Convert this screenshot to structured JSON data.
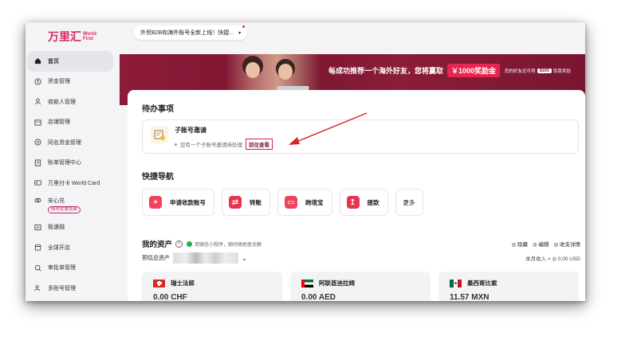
{
  "brand": {
    "name_cn": "万里汇",
    "name_en_1": "World",
    "name_en_2": "First"
  },
  "notice": {
    "text": "外贸B2B和海外账号全新上线！快捷...",
    "caret": "▾"
  },
  "sidebar": {
    "items": [
      {
        "label": "首页",
        "icon": "home-icon"
      },
      {
        "label": "资金管理",
        "icon": "money-icon"
      },
      {
        "label": "收款人管理",
        "icon": "user-icon"
      },
      {
        "label": "店铺管理",
        "icon": "shop-icon"
      },
      {
        "label": "同名资金管理",
        "icon": "transfer-icon"
      },
      {
        "label": "账单管理中心",
        "icon": "bill-icon"
      },
      {
        "label": "万里付卡 World Card",
        "icon": "card-icon"
      },
      {
        "label": "安心兑",
        "badge": "限时优惠免费",
        "icon": "exchange-icon"
      },
      {
        "label": "极速融",
        "icon": "finance-icon"
      },
      {
        "label": "全球开店",
        "icon": "store-icon"
      },
      {
        "label": "审批单管理",
        "icon": "approval-icon"
      },
      {
        "label": "多账号管理",
        "icon": "accounts-icon"
      }
    ]
  },
  "banner": {
    "headline": "每成功推荐一个海外好友，您将赢取",
    "reward": "￥1000奖励金",
    "sub_prefix": "您的好友还可得",
    "sub_amount": "$100",
    "sub_suffix": "惊喜奖励"
  },
  "todo": {
    "section_title": "待办事项",
    "item_title": "子账号邀请",
    "item_desc": "您有一个子账号邀请待处理",
    "item_link": "前往查看"
  },
  "quick_nav": {
    "section_title": "快捷导航",
    "items": [
      {
        "label": "申请收款账号",
        "icon_glyph": "+",
        "icon": "plus-icon"
      },
      {
        "label": "转账",
        "icon_glyph": "⇄",
        "icon": "transfer-icon"
      },
      {
        "label": "跨境宝",
        "icon_glyph": "▭",
        "icon": "cross-border-icon"
      },
      {
        "label": "提款",
        "icon_glyph": "↥",
        "icon": "withdraw-icon"
      }
    ],
    "more_label": "更多"
  },
  "assets": {
    "title": "我的资产",
    "info_glyph": "i",
    "hint": "用微信小程序，随时随地查余额",
    "hide_label": "◎ 隐藏",
    "edit_label": "◎ 编辑",
    "details_label": "◎ 收支详情",
    "total_label": "预估总资产",
    "chevron": "⌄",
    "income_label": "本月收入 ≈ ◎ 0.00 USD",
    "currencies": [
      {
        "name": "瑞士法郎",
        "amount": "0.00 CHF",
        "flag": "ch"
      },
      {
        "name": "阿联酋迪拉姆",
        "amount": "0.00 AED",
        "flag": "ae"
      },
      {
        "name": "墨西哥比索",
        "amount": "11.57 MXN",
        "flag": "mx"
      }
    ]
  },
  "colors": {
    "brand": "#d42a5e",
    "banner": "#7a1530",
    "highlight": "#d9232d"
  }
}
